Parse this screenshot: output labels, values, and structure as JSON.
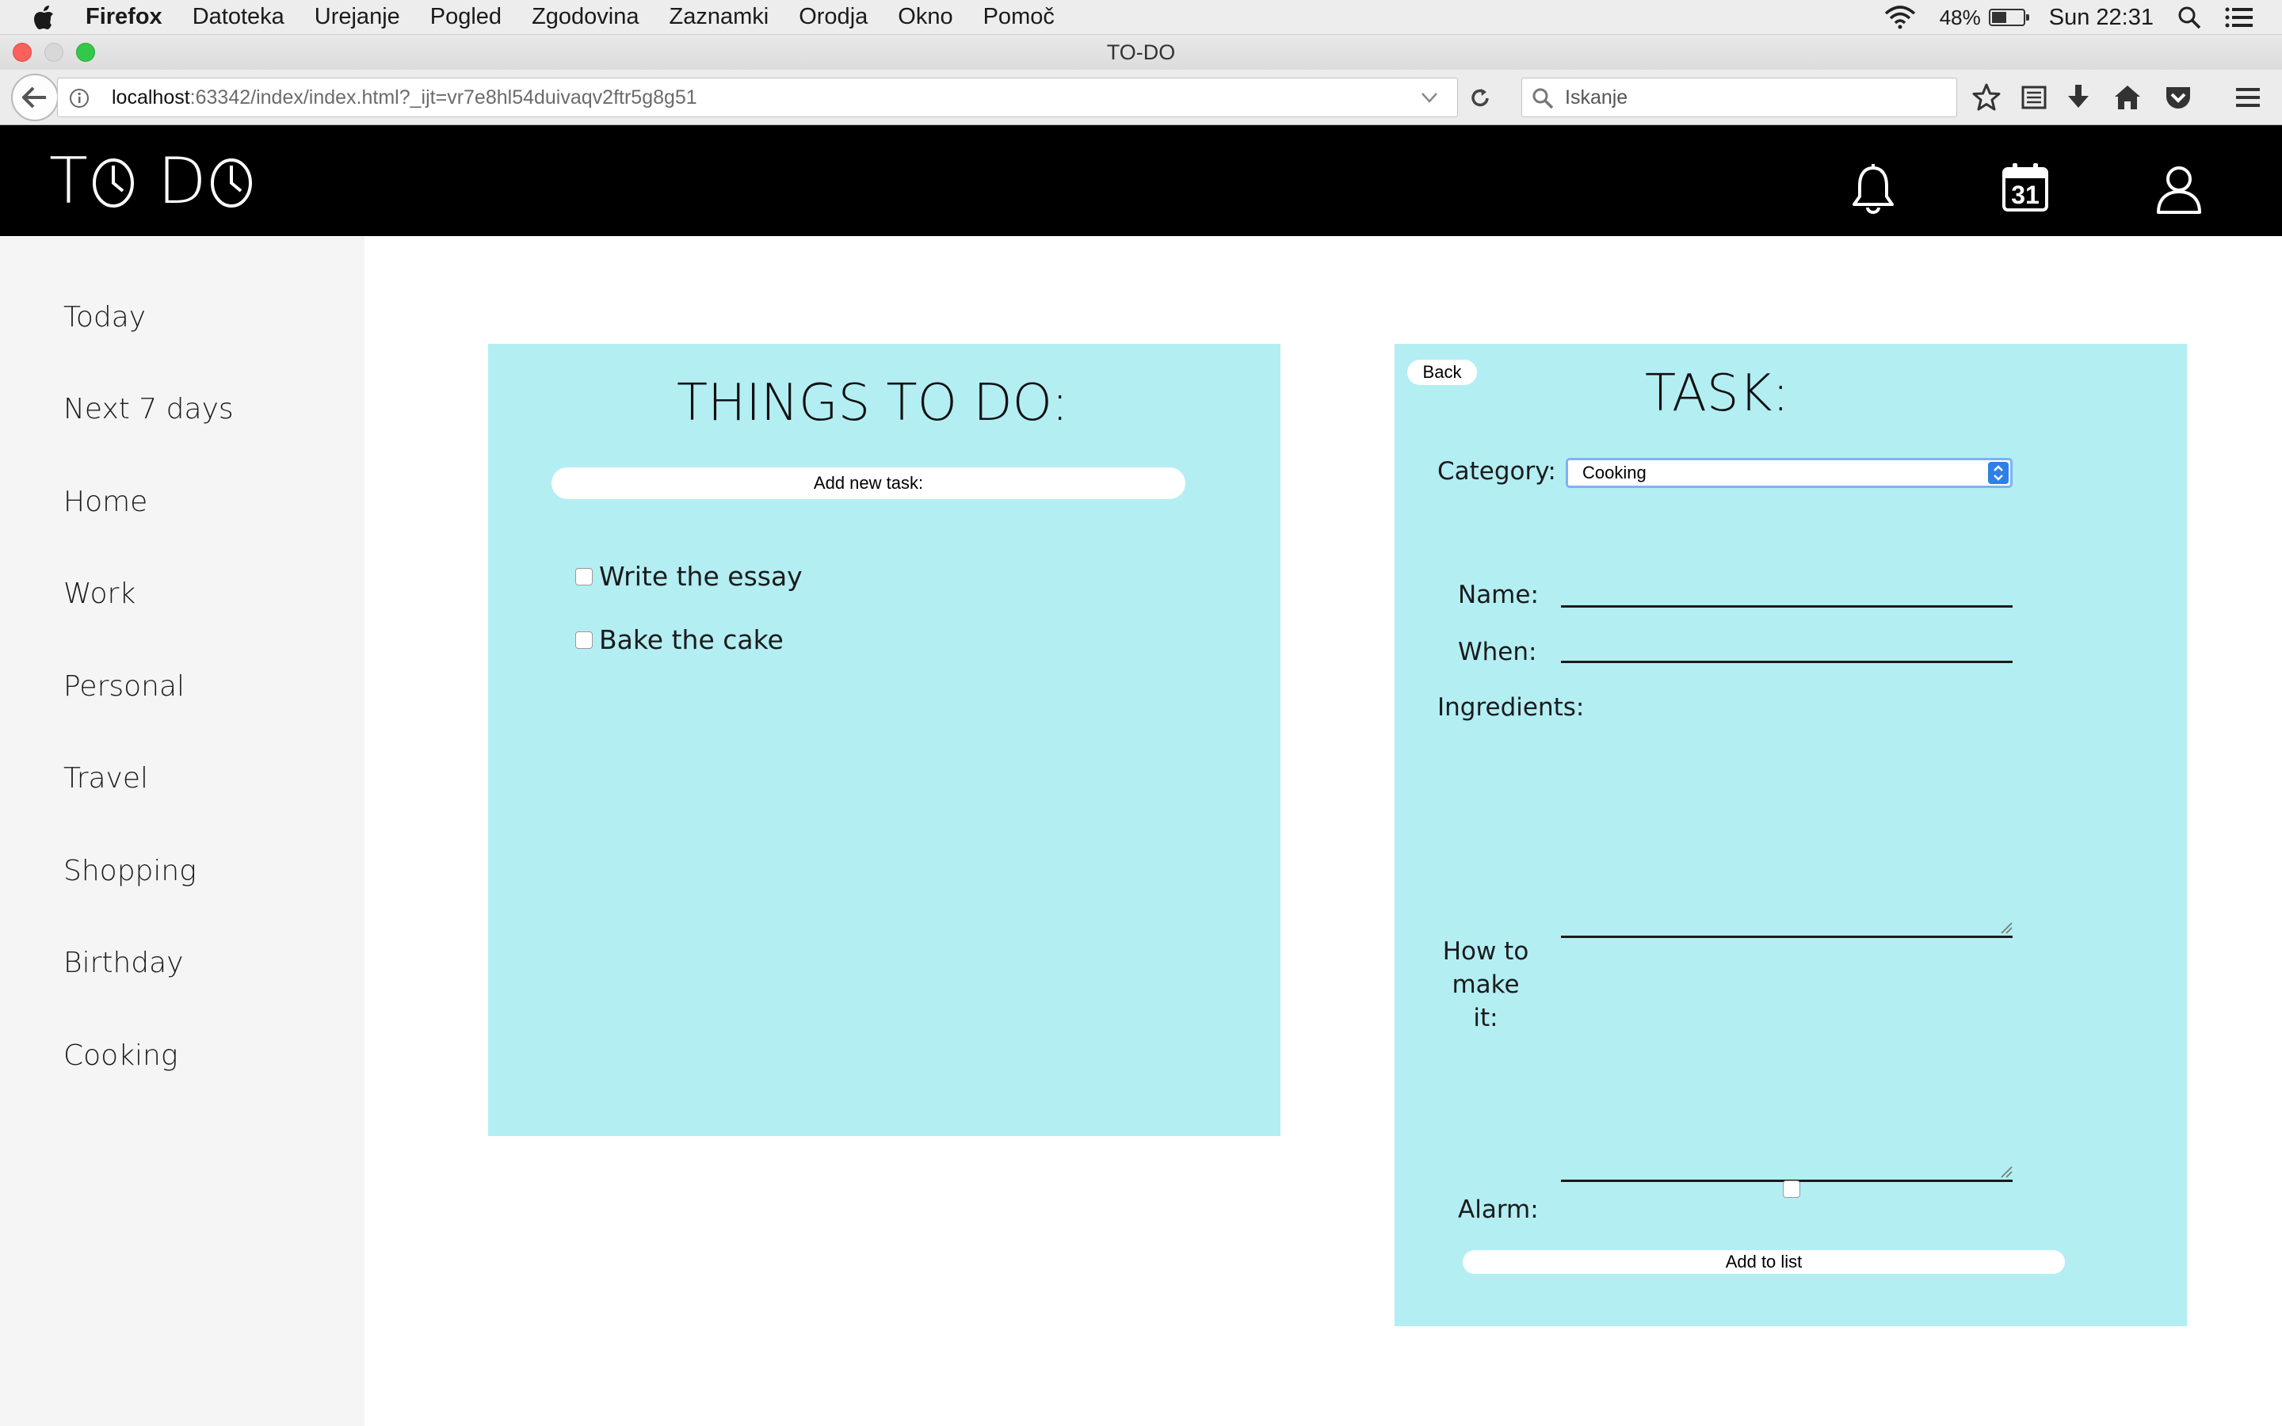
{
  "menubar": {
    "app_name": "Firefox",
    "items": [
      "Datoteka",
      "Urejanje",
      "Pogled",
      "Zgodovina",
      "Zaznamki",
      "Orodja",
      "Okno",
      "Pomoč"
    ],
    "battery": "48%",
    "battery_level": 0.48,
    "clock": "Sun 22:31"
  },
  "window": {
    "title": "TO-DO"
  },
  "browser": {
    "url_host": "localhost",
    "url_rest": ":63342/index/index.html?_ijt=vr7e8hl54duivaqv2ftr5g8g51",
    "search_placeholder": "Iskanje"
  },
  "app": {
    "logo_left": "T",
    "logo_mid": "D",
    "header_icons": [
      "bell-icon",
      "calendar-icon",
      "user-icon"
    ],
    "calendar_day": "31"
  },
  "sidebar": {
    "items": [
      "Today",
      "Next 7 days",
      "Home",
      "Work",
      "Personal",
      "Travel",
      "Shopping",
      "Birthday",
      "Cooking"
    ]
  },
  "things": {
    "title": "THINGS TO DO:",
    "add_button": "Add new task:",
    "tasks": [
      {
        "label": "Write the essay",
        "checked": false
      },
      {
        "label": "Bake the cake",
        "checked": false
      }
    ]
  },
  "task": {
    "back": "Back",
    "title": "TASK:",
    "category_label": "Category:",
    "category_value": "Cooking",
    "name_label": "Name:",
    "when_label": "When:",
    "ingredients_label": "Ingredients:",
    "howto_label_1": "How to",
    "howto_label_2": "make it:",
    "alarm_label": "Alarm:",
    "submit": "Add to list"
  },
  "colors": {
    "panel_bg": "#b3eef3",
    "header_bg": "#000000",
    "sidebar_bg": "#f5f5f5"
  }
}
